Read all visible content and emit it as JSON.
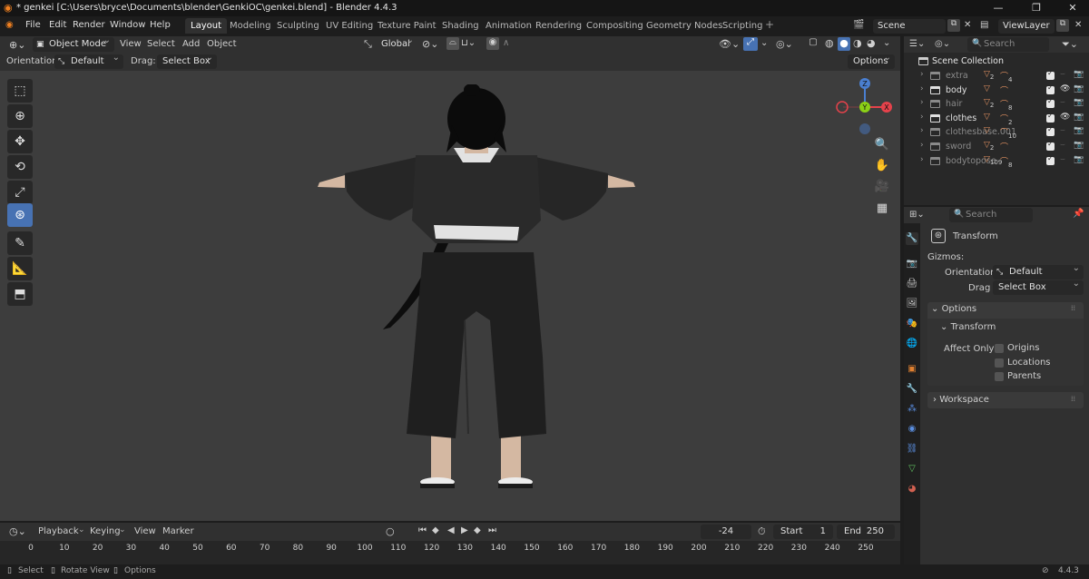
{
  "titlebar": {
    "title": "* genkei [C:\\Users\\bryce\\Documents\\blender\\GenkiOC\\genkei.blend] - Blender 4.4.3"
  },
  "menu": {
    "file": "File",
    "edit": "Edit",
    "render": "Render",
    "window": "Window",
    "help": "Help"
  },
  "workspaces": [
    "Layout",
    "Modeling",
    "Sculpting",
    "UV Editing",
    "Texture Paint",
    "Shading",
    "Animation",
    "Rendering",
    "Compositing",
    "Geometry Nodes",
    "Scripting"
  ],
  "scene": {
    "label": "Scene",
    "viewlayer": "ViewLayer"
  },
  "viewport_header": {
    "mode": "Object Mode",
    "view": "View",
    "select": "Select",
    "add": "Add",
    "object": "Object",
    "transform_orientation": "Global"
  },
  "tool_settings": {
    "orientation_label": "Orientation:",
    "orientation_value": "Default",
    "drag_label": "Drag:",
    "drag_value": "Select Box",
    "options": "Options"
  },
  "gizmo": {
    "z": "Z",
    "y": "Y",
    "x": "X"
  },
  "outliner": {
    "search_placeholder": "Search",
    "collection": "Scene Collection",
    "rows": [
      {
        "name": "extra",
        "enabled": false,
        "badge1": "2",
        "badge2": "4"
      },
      {
        "name": "body",
        "enabled": true,
        "badge1": "",
        "badge2": ""
      },
      {
        "name": "hair",
        "enabled": false,
        "badge1": "2",
        "badge2": "8"
      },
      {
        "name": "clothes",
        "enabled": true,
        "badge1": "",
        "badge2": "2"
      },
      {
        "name": "clothesbase.001",
        "enabled": false,
        "badge1": "",
        "badge2": "10"
      },
      {
        "name": "sword",
        "enabled": false,
        "badge1": "2",
        "badge2": ""
      },
      {
        "name": "bodytopose",
        "enabled": false,
        "badge1": "109",
        "badge2": "8"
      }
    ]
  },
  "properties": {
    "search_placeholder": "Search",
    "tool_name": "Transform",
    "gizmos_label": "Gizmos:",
    "orientation_label": "Orientation",
    "orientation_value": "Default",
    "drag_label": "Drag",
    "drag_value": "Select Box",
    "options_panel": "Options",
    "transform_sub": "Transform",
    "affect_only": "Affect Only",
    "origins": "Origins",
    "locations": "Locations",
    "parents": "Parents",
    "workspace_panel": "Workspace"
  },
  "timeline": {
    "playback": "Playback",
    "keying": "Keying",
    "view": "View",
    "marker": "Marker",
    "current_frame": "-24",
    "start_label": "Start",
    "start": "1",
    "end_label": "End",
    "end": "250",
    "ticks": [
      "0",
      "10",
      "20",
      "30",
      "40",
      "50",
      "60",
      "70",
      "80",
      "90",
      "100",
      "110",
      "120",
      "130",
      "140",
      "150",
      "160",
      "170",
      "180",
      "190",
      "200",
      "210",
      "220",
      "230",
      "240",
      "250"
    ]
  },
  "statusbar": {
    "select": "Select",
    "rotate": "Rotate View",
    "options": "Options",
    "version": "4.4.3"
  },
  "colors": {
    "accent": "#4772b3",
    "viewport_bg": "#3d3d3d",
    "panel": "#303030",
    "gizmo_x": "#e5424b",
    "gizmo_y": "#8bd016",
    "gizmo_z": "#4a7fd0"
  }
}
